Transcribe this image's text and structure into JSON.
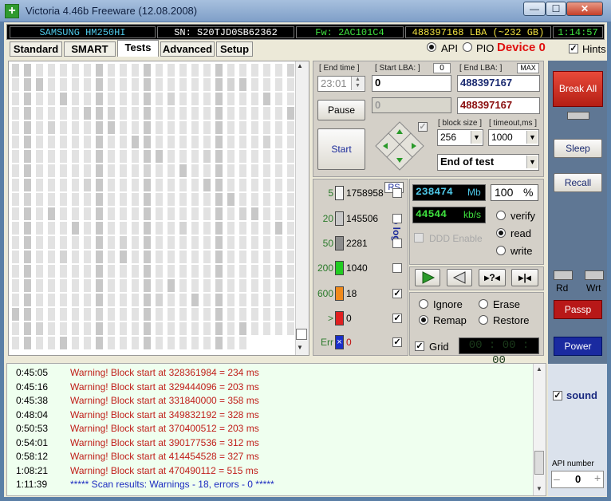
{
  "window": {
    "title": "Victoria 4.46b Freeware (12.08.2008)",
    "minimize": "—",
    "maximize": "☐",
    "close": "✕"
  },
  "info": {
    "model": "SAMSUNG HM250HI",
    "serial": "SN: S20TJD0SB62362",
    "firmware": "Fw: 2AC101C4",
    "lba": "488397168 LBA (~232 GB)",
    "clock": "1:14:57"
  },
  "tabs": [
    "Standard",
    "SMART",
    "Tests",
    "Advanced",
    "Setup"
  ],
  "mode": {
    "api": "API",
    "pio": "PIO",
    "device": "Device 0",
    "hints": "Hints"
  },
  "controls": {
    "end_time_label": "[ End time ]",
    "end_time": "23:01",
    "start_lba_label": "[ Start LBA: ]",
    "start_lba_zero": "0",
    "start_lba": "0",
    "start_lba_cur": "0",
    "end_lba_label": "[ End LBA: ]",
    "max_label": "MAX",
    "end_lba": "488397167",
    "end_lba2": "488397167",
    "pause": "Pause",
    "start": "Start",
    "block_size_label": "[ block size ]",
    "block_size": "256",
    "timeout_label": "[ timeout,ms ]",
    "timeout": "1000",
    "end_action": "End of test"
  },
  "stats": {
    "rs": "RS",
    "to_log": "to log:",
    "rows": [
      {
        "ms": "5",
        "count": "1758958",
        "color": "#f4f4f4",
        "log": false
      },
      {
        "ms": "20",
        "count": "145506",
        "color": "#c8c8c8",
        "log": false
      },
      {
        "ms": "50",
        "count": "2281",
        "color": "#8c8c8c",
        "log": false
      },
      {
        "ms": "200",
        "count": "1040",
        "color": "#22cc22",
        "log": false
      },
      {
        "ms": "600",
        "count": "18",
        "color": "#f08a1c",
        "log": true
      },
      {
        "ms": ">",
        "count": "0",
        "color": "#e02020",
        "log": true
      },
      {
        "ms": "Err",
        "count": "0",
        "color": "#1a2fc8",
        "log": true
      }
    ]
  },
  "progress": {
    "mb": "238474",
    "mb_unit": "Mb",
    "percent_text": "100",
    "percent_sign": "%",
    "percent": 100,
    "speed": "44544",
    "speed_unit": "kb/s",
    "ddd": "DDD Enable",
    "verify": "verify",
    "read": "read",
    "write": "write"
  },
  "actions": {
    "ignore": "Ignore",
    "erase": "Erase",
    "remap": "Remap",
    "restore": "Restore",
    "grid": "Grid",
    "timer": "00 : 00 : 00"
  },
  "right": {
    "break_all": "Break All",
    "sleep": "Sleep",
    "recall": "Recall",
    "rd": "Rd",
    "wrt": "Wrt",
    "passp": "Passp",
    "power": "Power",
    "sound": "sound",
    "api_number_label": "API number",
    "api_number": "0",
    "minus": "–",
    "plus": "+"
  },
  "log": [
    {
      "time": "0:45:05",
      "text": "Warning! Block start at 328361984 = 234 ms",
      "type": "warn"
    },
    {
      "time": "0:45:16",
      "text": "Warning! Block start at 329444096 = 203 ms",
      "type": "warn"
    },
    {
      "time": "0:45:38",
      "text": "Warning! Block start at 331840000 = 358 ms",
      "type": "warn"
    },
    {
      "time": "0:48:04",
      "text": "Warning! Block start at 349832192 = 328 ms",
      "type": "warn"
    },
    {
      "time": "0:50:53",
      "text": "Warning! Block start at 370400512 = 203 ms",
      "type": "warn"
    },
    {
      "time": "0:54:01",
      "text": "Warning! Block start at 390177536 = 312 ms",
      "type": "warn"
    },
    {
      "time": "0:58:12",
      "text": "Warning! Block start at 414454528 = 327 ms",
      "type": "warn"
    },
    {
      "time": "1:08:21",
      "text": "Warning! Block start at 470490112 = 515 ms",
      "type": "warn"
    },
    {
      "time": "1:11:39",
      "text": "***** Scan results: Warnings - 18, errors - 0 *****",
      "type": "result"
    }
  ]
}
